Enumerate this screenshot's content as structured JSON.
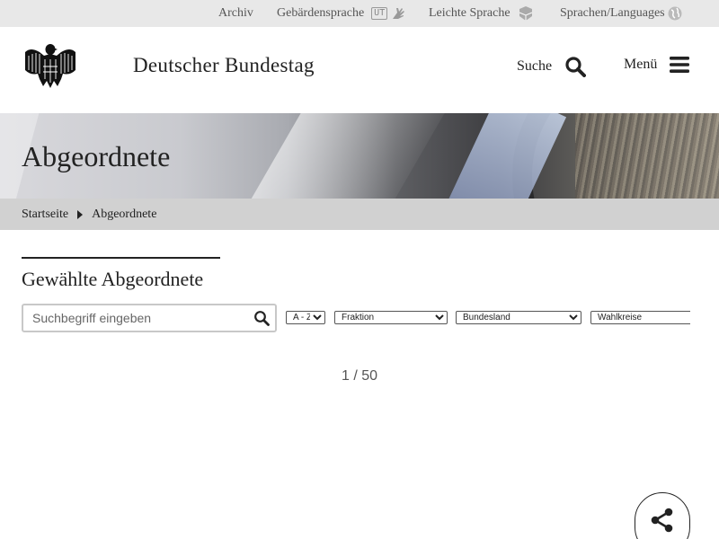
{
  "topbar": {
    "archive": "Archiv",
    "sign_language": "Gebärdensprache",
    "sign_language_badge": "UT",
    "easy_language": "Leichte Sprache",
    "languages": "Sprachen/Languages"
  },
  "header": {
    "brand": "Deutscher Bundestag",
    "search_label": "Suche",
    "menu_label": "Menü"
  },
  "hero": {
    "title": "Abgeordnete"
  },
  "breadcrumb": {
    "home": "Startseite",
    "current": "Abgeordnete"
  },
  "main": {
    "section_title": "Gewählte Abgeordnete",
    "search_placeholder": "Suchbegriff eingeben",
    "filters": {
      "sort": "A - Z",
      "faction": "Fraktion",
      "state": "Bundesland",
      "constituency": "Wahlkreise"
    },
    "pagination": "1 / 50"
  },
  "icons": {
    "search": "search-icon",
    "menu": "hamburger-icon",
    "share": "share-icon",
    "globe": "globe-icon",
    "easy_language": "easy-language-icon",
    "sign_language": "sign-hand-icon",
    "breadcrumb_sep": "caret-right-icon",
    "logo": "federal-eagle-icon"
  },
  "colors": {
    "topbar_bg": "#e8e8e8",
    "breadcrumb_bg": "#d1d1d1",
    "text": "#222222"
  }
}
